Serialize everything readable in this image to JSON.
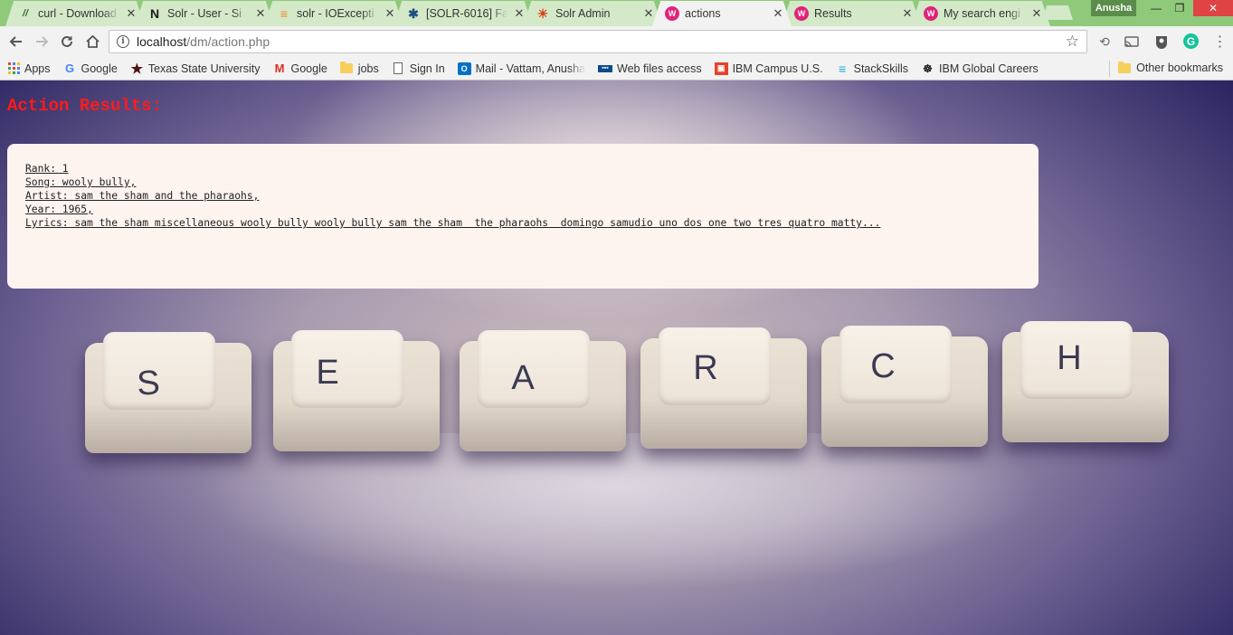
{
  "browser": {
    "tabs": [
      {
        "title": "curl - Download",
        "icon": "curl-icon",
        "icon_glyph": "//",
        "icon_color": "#3b6a2f"
      },
      {
        "title": "Solr - User - Si",
        "icon": "nabble-icon",
        "icon_glyph": "N",
        "icon_color": "#1c1c1c"
      },
      {
        "title": "solr - IOExcepti",
        "icon": "stackoverflow-icon",
        "icon_glyph": "≡",
        "icon_color": "#f48024"
      },
      {
        "title": "[SOLR-6016] Fa",
        "icon": "jira-icon",
        "icon_glyph": "✱",
        "icon_color": "#205081"
      },
      {
        "title": "Solr Admin",
        "icon": "solr-icon",
        "icon_glyph": "☀",
        "icon_color": "#d9411e"
      },
      {
        "title": "actions",
        "icon": "wamp-icon",
        "icon_glyph": "W",
        "icon_color": "#e0247a",
        "active": true
      },
      {
        "title": "Results",
        "icon": "wamp-icon",
        "icon_glyph": "W",
        "icon_color": "#e0247a"
      },
      {
        "title": "My search engi",
        "icon": "wamp-icon",
        "icon_glyph": "W",
        "icon_color": "#e0247a"
      }
    ],
    "profile_name": "Anusha",
    "address": {
      "host": "localhost",
      "path": "/dm/action.php"
    },
    "bookmarks": [
      {
        "label": "Apps",
        "icon": "apps-grid-icon"
      },
      {
        "label": "Google",
        "icon": "google-icon"
      },
      {
        "label": "Texas State University",
        "icon": "texas-state-star-icon"
      },
      {
        "label": "Google",
        "icon": "gmail-icon"
      },
      {
        "label": "jobs",
        "icon": "folder-icon"
      },
      {
        "label": "Sign In",
        "icon": "page-icon"
      },
      {
        "label": "Mail - Vattam, Anusha",
        "icon": "outlook-icon"
      },
      {
        "label": "Web files access",
        "icon": "web-files-icon"
      },
      {
        "label": "IBM Campus U.S.",
        "icon": "ibm-campus-icon"
      },
      {
        "label": "StackSkills",
        "icon": "stackskills-icon"
      },
      {
        "label": "IBM Global Careers",
        "icon": "ibm-careers-icon"
      }
    ],
    "other_bookmarks": "Other bookmarks"
  },
  "page": {
    "heading": "Action Results:",
    "result": {
      "rank": "Rank: 1",
      "song": "Song: wooly bully,",
      "artist": "Artist: sam the sham and the pharaohs,",
      "year": "Year: 1965,",
      "lyrics": "Lyrics: sam the sham miscellaneous wooly bully wooly bully sam the sham  the pharaohs  domingo samudio uno dos one two tres quatro matty..."
    },
    "background_keys": [
      "S",
      "E",
      "A",
      "R",
      "C",
      "H"
    ]
  },
  "colors": {
    "tabstrip": "#8fc97a",
    "heading": "#ff1b1b",
    "card": "#fdf4f0"
  }
}
